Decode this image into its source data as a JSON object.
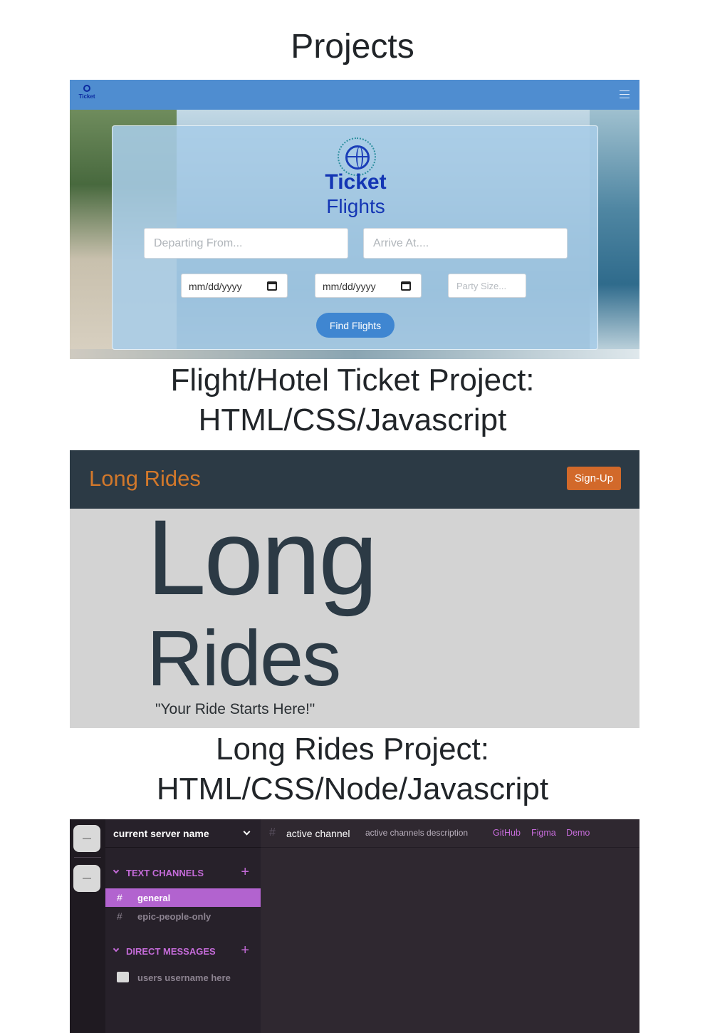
{
  "page": {
    "title": "Projects"
  },
  "projects": [
    {
      "caption_line1": "Flight/Hotel Ticket Project:",
      "caption_line2": "HTML/CSS/Javascript",
      "screenshot": {
        "nav_logo_text": "Ticket",
        "brand_line1": "Ticket",
        "brand_line2": "Flights",
        "departing_placeholder": "Departing From...",
        "arrive_placeholder": "Arrive At....",
        "date1": "mm/dd/yyyy",
        "date2": "mm/dd/yyyy",
        "party_placeholder": "Party Size...",
        "button": "Find Flights",
        "colors": {
          "nav": "#4f8dd0",
          "brand": "#1436b4",
          "button": "#3f86d1"
        }
      }
    },
    {
      "caption_line1": "Long Rides Project:",
      "caption_line2": "HTML/CSS/Node/Javascript",
      "screenshot": {
        "brand": "Long Rides",
        "signup": "Sign-Up",
        "hero_line1": "Long",
        "hero_line2": "Rides",
        "tagline": "\"Your Ride Starts Here!\"",
        "colors": {
          "nav": "#2c3a45",
          "accent": "#d2692a",
          "background": "#d3d3d3"
        }
      }
    },
    {
      "screenshot": {
        "server_name": "current server name",
        "text_channels_label": "TEXT CHANNELS",
        "channels": [
          {
            "name": "general",
            "active": true
          },
          {
            "name": "epic-people-only",
            "active": false
          }
        ],
        "direct_messages_label": "DIRECT MESSAGES",
        "dm_user": "users username here",
        "active_channel": "active channel",
        "active_channel_description": "active channels description",
        "links": [
          "GitHub",
          "Figma",
          "Demo"
        ],
        "colors": {
          "accent": "#c46bd8",
          "active_row": "#b263cf",
          "background": "#2f2830"
        }
      }
    }
  ]
}
